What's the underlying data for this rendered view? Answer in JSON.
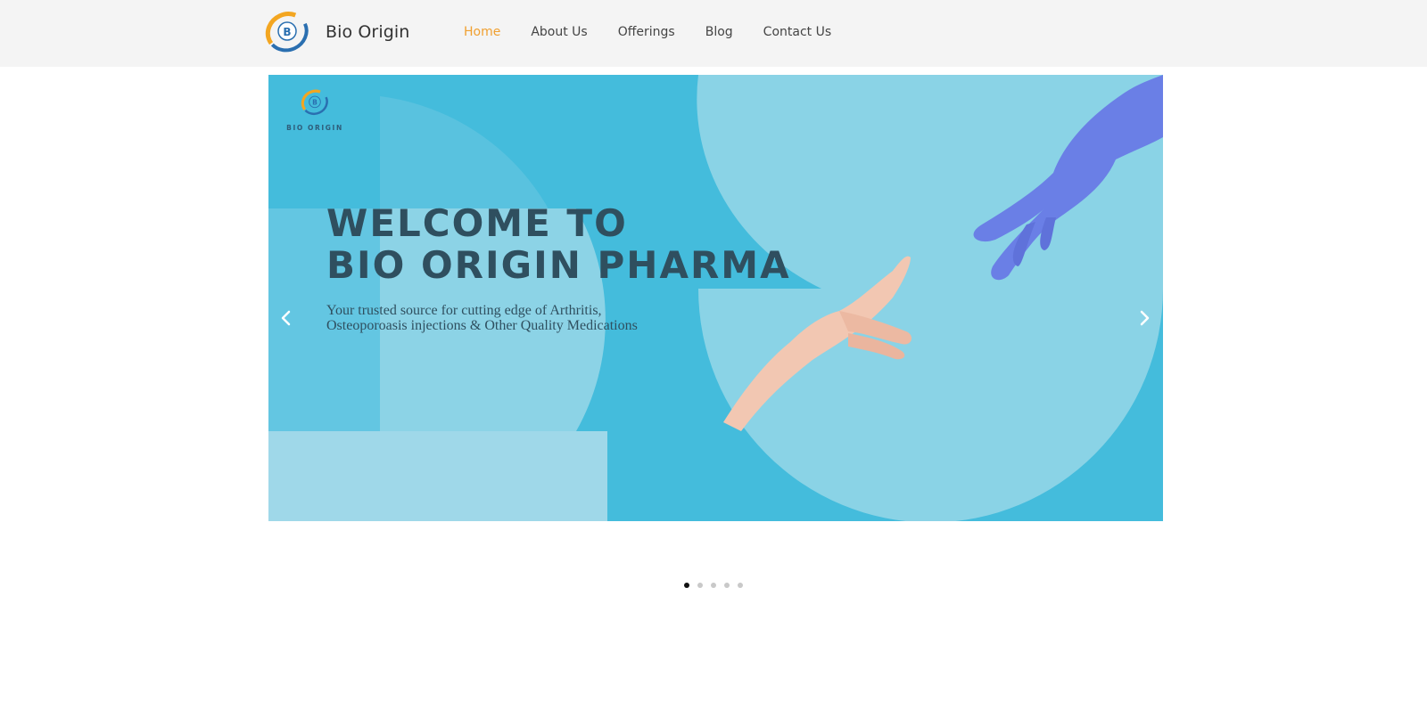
{
  "header": {
    "brand_name": "Bio Origin",
    "logo_letter": "B",
    "nav": [
      {
        "label": "Home",
        "active": true
      },
      {
        "label": "About Us",
        "active": false
      },
      {
        "label": "Offerings",
        "active": false
      },
      {
        "label": "Blog",
        "active": false
      },
      {
        "label": "Contact Us",
        "active": false
      }
    ]
  },
  "hero": {
    "logo_text": "BIO ORIGIN",
    "headline_line1": "WELCOME TO",
    "headline_line2": "BIO ORIGIN PHARMA",
    "tagline_line1": "Your trusted source for cutting edge of Arthritis,",
    "tagline_line2": "Osteoporoasis injections & Other Quality Medications",
    "prev_icon": "chevron-left-icon",
    "next_icon": "chevron-right-icon",
    "background_color": "#44bcdc",
    "glove_color": "#6a7fe6"
  },
  "carousel": {
    "slide_count": 5,
    "active_index": 0
  },
  "colors": {
    "accent": "#f0a030",
    "header_bg": "#f4f4f4",
    "text": "#444444"
  }
}
